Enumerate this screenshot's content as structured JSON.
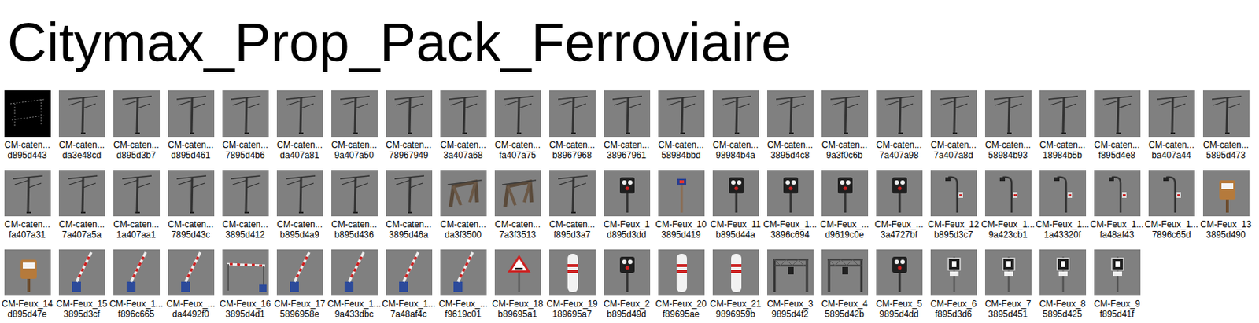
{
  "title": "Citymax_Prop_Pack_Ferroviaire",
  "items": [
    {
      "name": "CM-caten...",
      "id": "d895d443",
      "kind": "dark"
    },
    {
      "name": "CM-caten...",
      "id": "da3e48cd",
      "kind": "catenary"
    },
    {
      "name": "CM-caten...",
      "id": "d895d3b7",
      "kind": "catenary"
    },
    {
      "name": "CM-caten...",
      "id": "d895d461",
      "kind": "catenary"
    },
    {
      "name": "CM-caten...",
      "id": "7895d4b6",
      "kind": "catenary"
    },
    {
      "name": "CM-caten...",
      "id": "da407a81",
      "kind": "catenary"
    },
    {
      "name": "CM-caten...",
      "id": "9a407a50",
      "kind": "catenary"
    },
    {
      "name": "CM-caten...",
      "id": "78967949",
      "kind": "catenary"
    },
    {
      "name": "CM-caten...",
      "id": "3a407a68",
      "kind": "catenary"
    },
    {
      "name": "CM-caten...",
      "id": "fa407a75",
      "kind": "catenary"
    },
    {
      "name": "CM-caten...",
      "id": "b8967968",
      "kind": "catenary"
    },
    {
      "name": "CM-caten...",
      "id": "38967961",
      "kind": "catenary"
    },
    {
      "name": "CM-caten...",
      "id": "58984bbd",
      "kind": "catenary"
    },
    {
      "name": "CM-caten...",
      "id": "98984b4a",
      "kind": "catenary"
    },
    {
      "name": "CM-caten...",
      "id": "3895d4c8",
      "kind": "catenary"
    },
    {
      "name": "CM-caten...",
      "id": "9a3f0c6b",
      "kind": "catenary"
    },
    {
      "name": "CM-caten...",
      "id": "7a407a98",
      "kind": "catenary"
    },
    {
      "name": "CM-caten...",
      "id": "7a407a8d",
      "kind": "catenary"
    },
    {
      "name": "CM-caten...",
      "id": "58984b93",
      "kind": "catenary"
    },
    {
      "name": "CM-caten...",
      "id": "18984b5b",
      "kind": "catenary"
    },
    {
      "name": "CM-caten...",
      "id": "f895d4e8",
      "kind": "catenary"
    },
    {
      "name": "CM-caten...",
      "id": "ba407a44",
      "kind": "catenary"
    },
    {
      "name": "CM-caten...",
      "id": "5895d473",
      "kind": "catenary"
    },
    {
      "name": "CM-caten...",
      "id": "fa407a31",
      "kind": "catenary"
    },
    {
      "name": "CM-caten...",
      "id": "7a407a5a",
      "kind": "catenary"
    },
    {
      "name": "CM-caten...",
      "id": "1a407aa1",
      "kind": "catenary"
    },
    {
      "name": "CM-caten...",
      "id": "7895d43c",
      "kind": "catenary"
    },
    {
      "name": "CM-caten...",
      "id": "3895d412",
      "kind": "catenary"
    },
    {
      "name": "CM-caten...",
      "id": "b895d4a9",
      "kind": "catenary"
    },
    {
      "name": "CM-caten...",
      "id": "b895d436",
      "kind": "catenary"
    },
    {
      "name": "CM-caten...",
      "id": "3895d46a",
      "kind": "catenary"
    },
    {
      "name": "CM-caten...",
      "id": "da3f3500",
      "kind": "crossing"
    },
    {
      "name": "CM-caten...",
      "id": "7a3f3513",
      "kind": "crossing"
    },
    {
      "name": "CM-caten...",
      "id": "f895d3a7",
      "kind": "catenary"
    },
    {
      "name": "CM-Feux_1",
      "id": "d895d3dd",
      "kind": "signal"
    },
    {
      "name": "CM-Feux_10",
      "id": "3895d419",
      "kind": "post"
    },
    {
      "name": "CM-Feux_11",
      "id": "b895d44a",
      "kind": "signal"
    },
    {
      "name": "CM-Feux_1...",
      "id": "3896c694",
      "kind": "signal"
    },
    {
      "name": "CM-Feux_...",
      "id": "d9619c0e",
      "kind": "signal"
    },
    {
      "name": "CM-Feux_...",
      "id": "3a4727bf",
      "kind": "signal"
    },
    {
      "name": "CM-Feux_12",
      "id": "b895d3c7",
      "kind": "lamp"
    },
    {
      "name": "CM-Feux_1...",
      "id": "9a423cb1",
      "kind": "lamp"
    },
    {
      "name": "CM-Feux_1...",
      "id": "1a43320f",
      "kind": "lamp"
    },
    {
      "name": "CM-Feux_1...",
      "id": "fa48af43",
      "kind": "lamp"
    },
    {
      "name": "CM-Feux_1...",
      "id": "7896c65d",
      "kind": "lamp"
    },
    {
      "name": "CM-Feux_13",
      "id": "3895d490",
      "kind": "box"
    },
    {
      "name": "CM-Feux_14",
      "id": "d895d47e",
      "kind": "box"
    },
    {
      "name": "CM-Feux_15",
      "id": "3895d3cf",
      "kind": "barrier"
    },
    {
      "name": "CM-Feux_1...",
      "id": "f896c665",
      "kind": "barrier"
    },
    {
      "name": "CM-Feux_...",
      "id": "da4492f0",
      "kind": "barrier"
    },
    {
      "name": "CM-Feux_16",
      "id": "3895d4d1",
      "kind": "gate"
    },
    {
      "name": "CM-Feux_17",
      "id": "5896958e",
      "kind": "barrier"
    },
    {
      "name": "CM-Feux_1...",
      "id": "9a433dbc",
      "kind": "barrier"
    },
    {
      "name": "CM-Feux_1...",
      "id": "7a48af4c",
      "kind": "barrier"
    },
    {
      "name": "CM-Feux_...",
      "id": "f9619c01",
      "kind": "barrier"
    },
    {
      "name": "CM-Feux_18",
      "id": "b89695a1",
      "kind": "triangle"
    },
    {
      "name": "CM-Feux_19",
      "id": "189695a7",
      "kind": "marker"
    },
    {
      "name": "CM-Feux_2",
      "id": "b895d49d",
      "kind": "signal"
    },
    {
      "name": "CM-Feux_20",
      "id": "f89695ae",
      "kind": "marker"
    },
    {
      "name": "CM-Feux_21",
      "id": "9896959b",
      "kind": "marker"
    },
    {
      "name": "CM-Feux_3",
      "id": "9895d4f2",
      "kind": "gantry"
    },
    {
      "name": "CM-Feux_4",
      "id": "5895d42b",
      "kind": "gantry"
    },
    {
      "name": "CM-Feux_5",
      "id": "9895d4dd",
      "kind": "signal"
    },
    {
      "name": "CM-Feux_6",
      "id": "f895d3d6",
      "kind": "sign"
    },
    {
      "name": "CM-Feux_7",
      "id": "3895d451",
      "kind": "sign"
    },
    {
      "name": "CM-Feux_8",
      "id": "5895d425",
      "kind": "sign"
    },
    {
      "name": "CM-Feux_9",
      "id": "f895d41f",
      "kind": "sign"
    }
  ]
}
